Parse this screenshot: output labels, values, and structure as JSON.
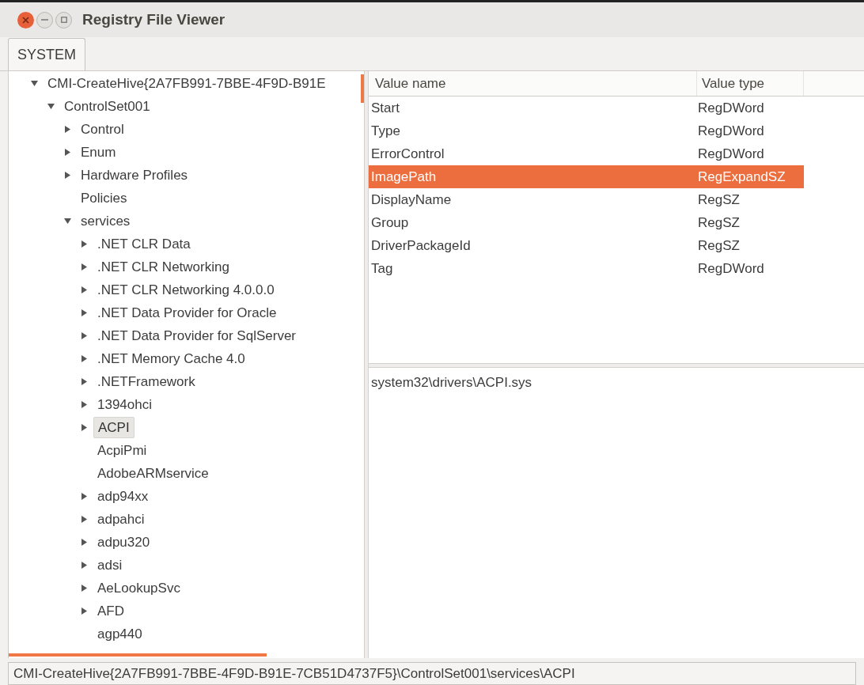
{
  "window": {
    "title": "Registry File Viewer"
  },
  "tabs": [
    {
      "label": "SYSTEM",
      "selected": true
    }
  ],
  "tree": [
    {
      "label": "CMI-CreateHive{2A7FB991-7BBE-4F9D-B91E",
      "kind": "branch",
      "expanded": true,
      "selected": false,
      "children": [
        {
          "label": "ControlSet001",
          "kind": "branch",
          "expanded": true,
          "selected": false,
          "children": [
            {
              "label": "Control",
              "kind": "branch",
              "expanded": false,
              "selected": false
            },
            {
              "label": "Enum",
              "kind": "branch",
              "expanded": false,
              "selected": false
            },
            {
              "label": "Hardware Profiles",
              "kind": "branch",
              "expanded": false,
              "selected": false
            },
            {
              "label": "Policies",
              "kind": "leaf",
              "selected": false
            },
            {
              "label": "services",
              "kind": "branch",
              "expanded": true,
              "selected": false,
              "children": [
                {
                  "label": ".NET CLR Data",
                  "kind": "branch",
                  "expanded": false,
                  "selected": false
                },
                {
                  "label": ".NET CLR Networking",
                  "kind": "branch",
                  "expanded": false,
                  "selected": false
                },
                {
                  "label": ".NET CLR Networking 4.0.0.0",
                  "kind": "branch",
                  "expanded": false,
                  "selected": false
                },
                {
                  "label": ".NET Data Provider for Oracle",
                  "kind": "branch",
                  "expanded": false,
                  "selected": false
                },
                {
                  "label": ".NET Data Provider for SqlServer",
                  "kind": "branch",
                  "expanded": false,
                  "selected": false
                },
                {
                  "label": ".NET Memory Cache 4.0",
                  "kind": "branch",
                  "expanded": false,
                  "selected": false
                },
                {
                  "label": ".NETFramework",
                  "kind": "branch",
                  "expanded": false,
                  "selected": false
                },
                {
                  "label": "1394ohci",
                  "kind": "branch",
                  "expanded": false,
                  "selected": false
                },
                {
                  "label": "ACPI",
                  "kind": "branch",
                  "expanded": false,
                  "selected": true
                },
                {
                  "label": "AcpiPmi",
                  "kind": "leaf",
                  "selected": false
                },
                {
                  "label": "AdobeARMservice",
                  "kind": "leaf",
                  "selected": false
                },
                {
                  "label": "adp94xx",
                  "kind": "branch",
                  "expanded": false,
                  "selected": false
                },
                {
                  "label": "adpahci",
                  "kind": "branch",
                  "expanded": false,
                  "selected": false
                },
                {
                  "label": "adpu320",
                  "kind": "branch",
                  "expanded": false,
                  "selected": false
                },
                {
                  "label": "adsi",
                  "kind": "branch",
                  "expanded": false,
                  "selected": false
                },
                {
                  "label": "AeLookupSvc",
                  "kind": "branch",
                  "expanded": false,
                  "selected": false
                },
                {
                  "label": "AFD",
                  "kind": "branch",
                  "expanded": false,
                  "selected": false
                },
                {
                  "label": "agp440",
                  "kind": "leaf",
                  "selected": false
                }
              ]
            }
          ]
        }
      ]
    }
  ],
  "values_table": {
    "columns": [
      "Value name",
      "Value type"
    ],
    "rows": [
      {
        "name": "Start",
        "type": "RegDWord",
        "selected": false
      },
      {
        "name": "Type",
        "type": "RegDWord",
        "selected": false
      },
      {
        "name": "ErrorControl",
        "type": "RegDWord",
        "selected": false
      },
      {
        "name": "ImagePath",
        "type": "RegExpandSZ",
        "selected": true
      },
      {
        "name": "DisplayName",
        "type": "RegSZ",
        "selected": false
      },
      {
        "name": "Group",
        "type": "RegSZ",
        "selected": false
      },
      {
        "name": "DriverPackageId",
        "type": "RegSZ",
        "selected": false
      },
      {
        "name": "Tag",
        "type": "RegDWord",
        "selected": false
      }
    ]
  },
  "value_data": "system32\\drivers\\ACPI.sys",
  "status_bar": "CMI-CreateHive{2A7FB991-7BBE-4F9D-B91E-7CB51D4737F5}\\ControlSet001\\services\\ACPI"
}
